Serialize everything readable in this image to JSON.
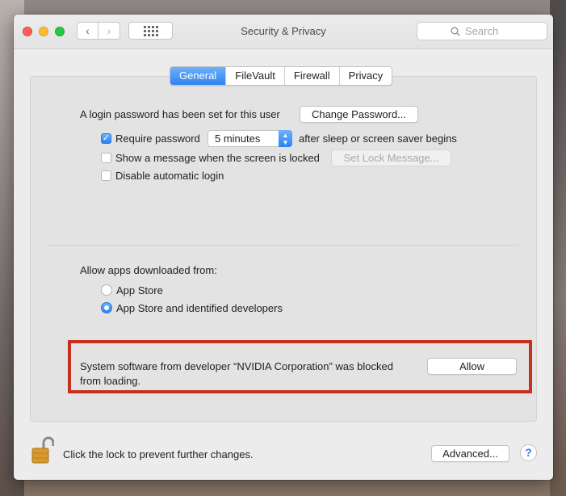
{
  "window": {
    "title": "Security & Privacy",
    "search_placeholder": "Search"
  },
  "toolbar": {
    "back_glyph": "‹",
    "forward_glyph": "›"
  },
  "tabs": [
    {
      "label": "General",
      "active": true
    },
    {
      "label": "FileVault",
      "active": false
    },
    {
      "label": "Firewall",
      "active": false
    },
    {
      "label": "Privacy",
      "active": false
    }
  ],
  "general": {
    "login_password_text": "A login password has been set for this user",
    "change_password_label": "Change Password...",
    "require_password": {
      "label": "Require password",
      "checked": true
    },
    "require_password_delay": "5 minutes",
    "after_sleep_text": "after sleep or screen saver begins",
    "show_message": {
      "label": "Show a message when the screen is locked",
      "checked": false
    },
    "set_lock_message_label": "Set Lock Message...",
    "disable_auto_login": {
      "label": "Disable automatic login",
      "checked": false
    },
    "allow_apps_heading": "Allow apps downloaded from:",
    "radio_app_store": {
      "label": "App Store",
      "selected": false
    },
    "radio_identified": {
      "label": "App Store and identified developers",
      "selected": true
    },
    "blocked_message_line1": "System software from developer “NVIDIA Corporation” was blocked",
    "blocked_message_line2": "from loading.",
    "allow_label": "Allow"
  },
  "footer": {
    "lock_text": "Click the lock to prevent further changes.",
    "advanced_label": "Advanced...",
    "help_label": "?"
  },
  "icons": {
    "lock": "lock-open-icon",
    "search": "search-icon",
    "grid": "show-all-grid-icon",
    "help": "help-icon"
  },
  "colors": {
    "accent": "#2e82f2",
    "highlight_border": "#c6301f",
    "lock_gold": "#d69a2d"
  }
}
